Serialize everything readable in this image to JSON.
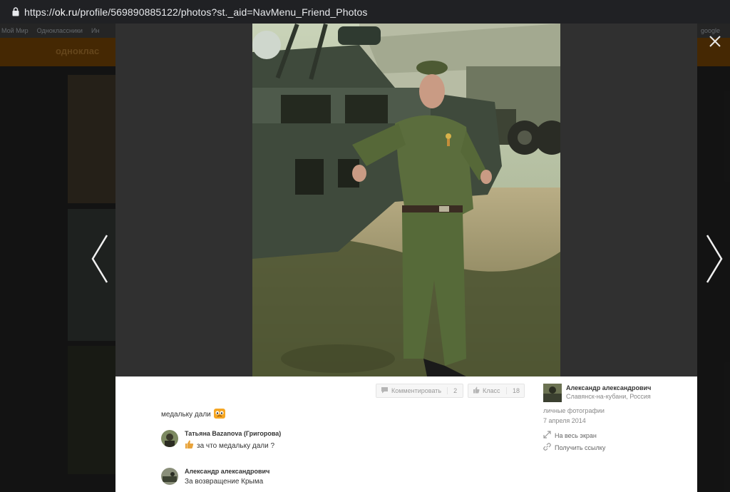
{
  "browser": {
    "url_scheme": "https://",
    "url_host": "ok.ru",
    "url_path": "/profile/569890885122/photos?st._aid=NavMenu_Friend_Photos"
  },
  "background": {
    "bookmarks": [
      "Мой Мир",
      "Одноклассники",
      "Ин",
      "google"
    ],
    "logo_text": "одноклас"
  },
  "toolbar": {
    "comment_label": "Комментировать",
    "comment_count": "2",
    "class_label": "Класс",
    "class_count": "18"
  },
  "photo": {
    "description": "медальку дали"
  },
  "comments": [
    {
      "author": "Татьяна Bazanova (Григорова)",
      "text": "за что медальку дали ?"
    },
    {
      "author": "Александр александрович",
      "text": "За возвращение Крыма"
    }
  ],
  "owner": {
    "name": "Александр александрович",
    "location": "Славянск-на-кубани, Россия",
    "album": "личные фотографии",
    "date": "7 апреля 2014"
  },
  "actions": {
    "fullscreen": "На весь экран",
    "get_link": "Получить ссылку"
  },
  "colors": {
    "accent": "#ee8208",
    "panel_bg": "#ffffff",
    "stage_bg": "#303030"
  }
}
